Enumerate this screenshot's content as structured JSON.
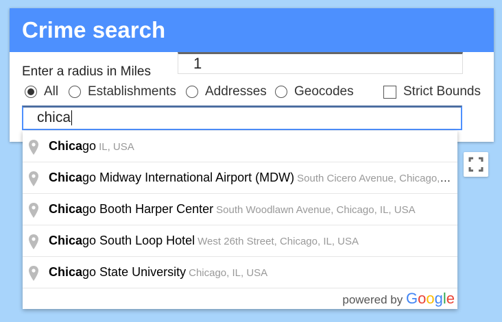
{
  "panel": {
    "title": "Crime search",
    "radius_label": "Enter a radius in Miles",
    "radius_value": "1",
    "types": [
      {
        "label": "All",
        "checked": true
      },
      {
        "label": "Establishments",
        "checked": false
      },
      {
        "label": "Addresses",
        "checked": false
      },
      {
        "label": "Geocodes",
        "checked": false
      }
    ],
    "strict_bounds_label": "Strict Bounds",
    "search_value": "chica"
  },
  "suggestions": [
    {
      "match": "Chica",
      "rest": "go",
      "secondary": "IL, USA"
    },
    {
      "match": "Chica",
      "rest": "go Midway International Airport (MDW)",
      "secondary": "South Cicero Avenue, Chicago, IL, USA"
    },
    {
      "match": "Chica",
      "rest": "go Booth Harper Center",
      "secondary": "South Woodlawn Avenue, Chicago, IL, USA"
    },
    {
      "match": "Chica",
      "rest": "go South Loop Hotel",
      "secondary": "West 26th Street, Chicago, IL, USA"
    },
    {
      "match": "Chica",
      "rest": "go State University",
      "secondary": "Chicago, IL, USA"
    }
  ],
  "powered_by": "powered by",
  "google_logo": [
    "G",
    "o",
    "o",
    "g",
    "l",
    "e"
  ],
  "colors": {
    "header": "#4d90fe",
    "map_background": "#a8d4fb",
    "google": [
      "#4285F4",
      "#EA4335",
      "#FBBC05",
      "#4285F4",
      "#34A853",
      "#EA4335"
    ]
  },
  "icons": {
    "pin": "map-pin-icon",
    "fullscreen": "fullscreen-icon"
  }
}
